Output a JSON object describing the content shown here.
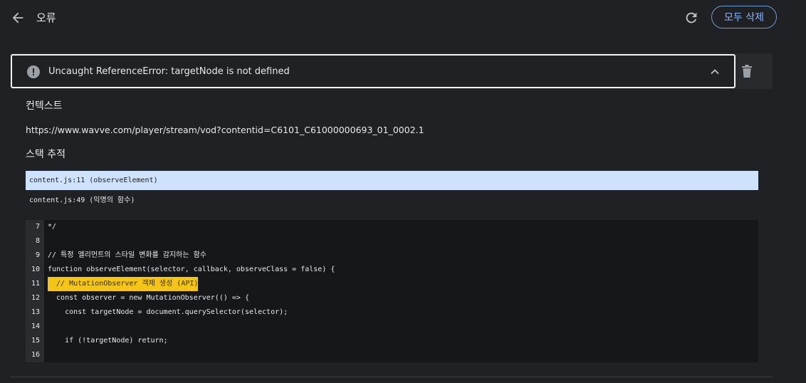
{
  "header": {
    "title": "오류",
    "clear_all": "모두 삭제"
  },
  "error": {
    "message": "Uncaught ReferenceError: targetNode is not defined"
  },
  "context": {
    "heading": "컨텍스트",
    "url": "https://www.wavve.com/player/stream/vod?contentid=C6101_C61000000693_01_0002.1"
  },
  "stack": {
    "heading": "스택 추적",
    "frames": [
      "content.js:11 (observeElement)",
      "content.js:49 (익명의 함수)"
    ]
  },
  "code": {
    "lines": [
      {
        "n": "7",
        "text": "*/"
      },
      {
        "n": "8",
        "text": ""
      },
      {
        "n": "9",
        "text": "// 특정 엘리먼트의 스타일 변화를 감지하는 함수"
      },
      {
        "n": "10",
        "text": "function observeElement(selector, callback, observeClass = false) {"
      },
      {
        "n": "11",
        "text": "  // MutationObserver 객체 생성 (API)"
      },
      {
        "n": "12",
        "text": "  const observer = new MutationObserver(() => {"
      },
      {
        "n": "13",
        "text": "    const targetNode = document.querySelector(selector);"
      },
      {
        "n": "14",
        "text": ""
      },
      {
        "n": "15",
        "text": "    if (!targetNode) return;"
      },
      {
        "n": "16",
        "text": ""
      }
    ]
  },
  "colors": {
    "accent": "#8ab4f8",
    "highlight": "#f4c518",
    "selected_frame": "#cfe2fc"
  }
}
